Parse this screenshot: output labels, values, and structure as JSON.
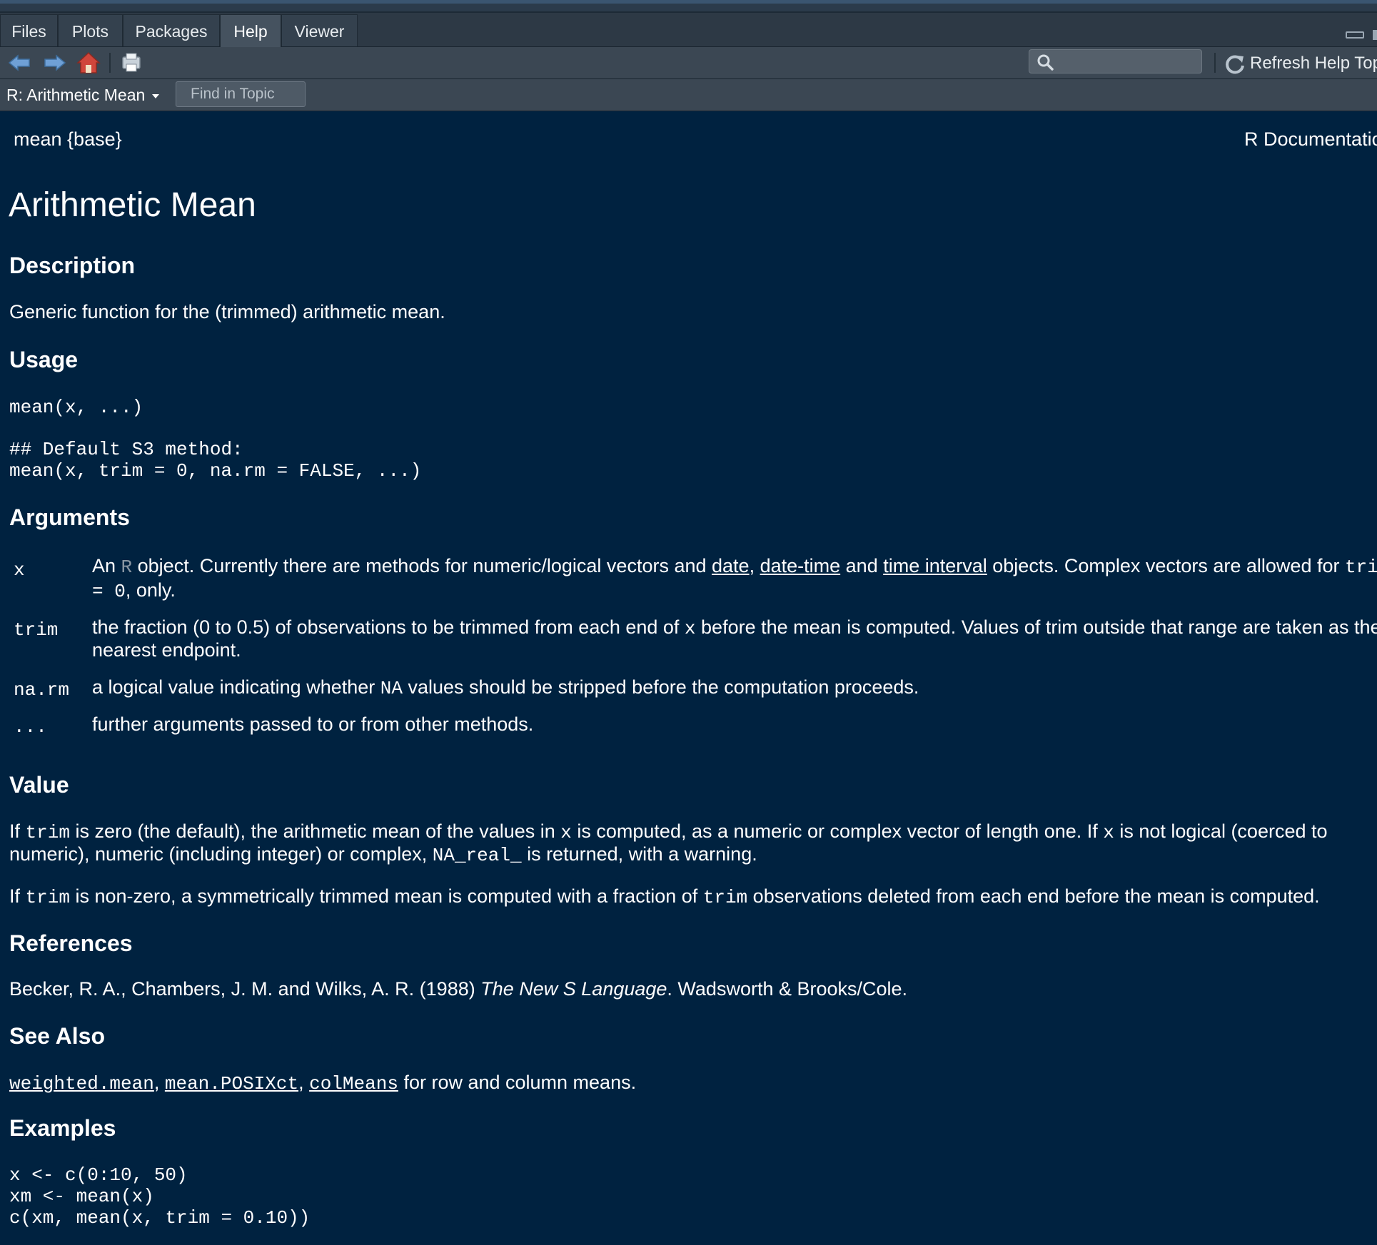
{
  "tabs": [
    "Files",
    "Plots",
    "Packages",
    "Help",
    "Viewer"
  ],
  "active_tab": "Help",
  "toolbar": {
    "refresh_label": "Refresh Help Top",
    "icons": [
      "back-arrow-icon",
      "forward-arrow-icon",
      "home-icon",
      "print-icon",
      "search-icon",
      "refresh-icon"
    ]
  },
  "topic": {
    "selector_label": "R: Arithmetic Mean",
    "find_button": "Find in Topic"
  },
  "doc": {
    "header_left": "mean {base}",
    "header_right": "R Documentatio",
    "title": "Arithmetic Mean",
    "description_heading": "Description",
    "description_text": "Generic function for the (trimmed) arithmetic mean.",
    "usage_heading": "Usage",
    "usage_code_1": "mean(x, ...)",
    "usage_code_2": "## Default S3 method:",
    "usage_code_3": "mean(x, trim = 0, na.rm = FALSE, ...)",
    "arguments_heading": "Arguments",
    "arg_x": {
      "name": "x",
      "t1": "An ",
      "r": "R",
      "t2": " object. Currently there are methods for numeric/logical vectors and ",
      "link_date": "date",
      "t3": ", ",
      "link_datetime": "date-time",
      "t4": " and ",
      "link_interval": "time interval",
      "t5": " objects. Complex vectors are allowed for ",
      "code_tri": "tri",
      "code_eq": "= 0",
      "t6": ", only."
    },
    "arg_trim": {
      "name": "trim",
      "t1": "the fraction (0 to 0.5) of observations to be trimmed from each end of ",
      "code_x": "x",
      "t2": " before the mean is computed. Values of trim outside that range are taken as the",
      "line2": "nearest endpoint."
    },
    "arg_narm": {
      "name": "na.rm",
      "t1": "a logical value indicating whether ",
      "code_na": "NA",
      "t2": " values should be stripped before the computation proceeds."
    },
    "arg_dots": {
      "name": "...",
      "text": "further arguments passed to or from other methods."
    },
    "value_heading": "Value",
    "value_p1": {
      "t1": "If ",
      "code_trim": "trim",
      "t2": " is zero (the default), the arithmetic mean of the values in ",
      "code_x": "x",
      "t3": " is computed, as a numeric or complex vector of length one. If ",
      "code_x2": "x",
      "t4": " is not logical (coerced to",
      "l2_t1": "numeric), numeric (including integer) or complex, ",
      "code_na_real": "NA_real_",
      "l2_t2": " is returned, with a warning."
    },
    "value_p2": {
      "t1": "If ",
      "code_trim": "trim",
      "t2": " is non-zero, a symmetrically trimmed mean is computed with a fraction of ",
      "code_trim2": "trim",
      "t3": " observations deleted from each end before the mean is computed."
    },
    "references_heading": "References",
    "reference": {
      "t1": "Becker, R. A., Chambers, J. M. and Wilks, A. R. (1988) ",
      "italic": "The New S Language",
      "t2": ". Wadsworth & Brooks/Cole."
    },
    "seealso_heading": "See Also",
    "seealso": {
      "link1": "weighted.mean",
      "sep1": ", ",
      "link2": "mean.POSIXct",
      "sep2": ", ",
      "link3": "colMeans",
      "tail": " for row and column means."
    },
    "examples_heading": "Examples",
    "example_1": "x <- c(0:10, 50)",
    "example_2": "xm <- mean(x)",
    "example_3": "c(xm, mean(x, trim = 0.10))"
  }
}
